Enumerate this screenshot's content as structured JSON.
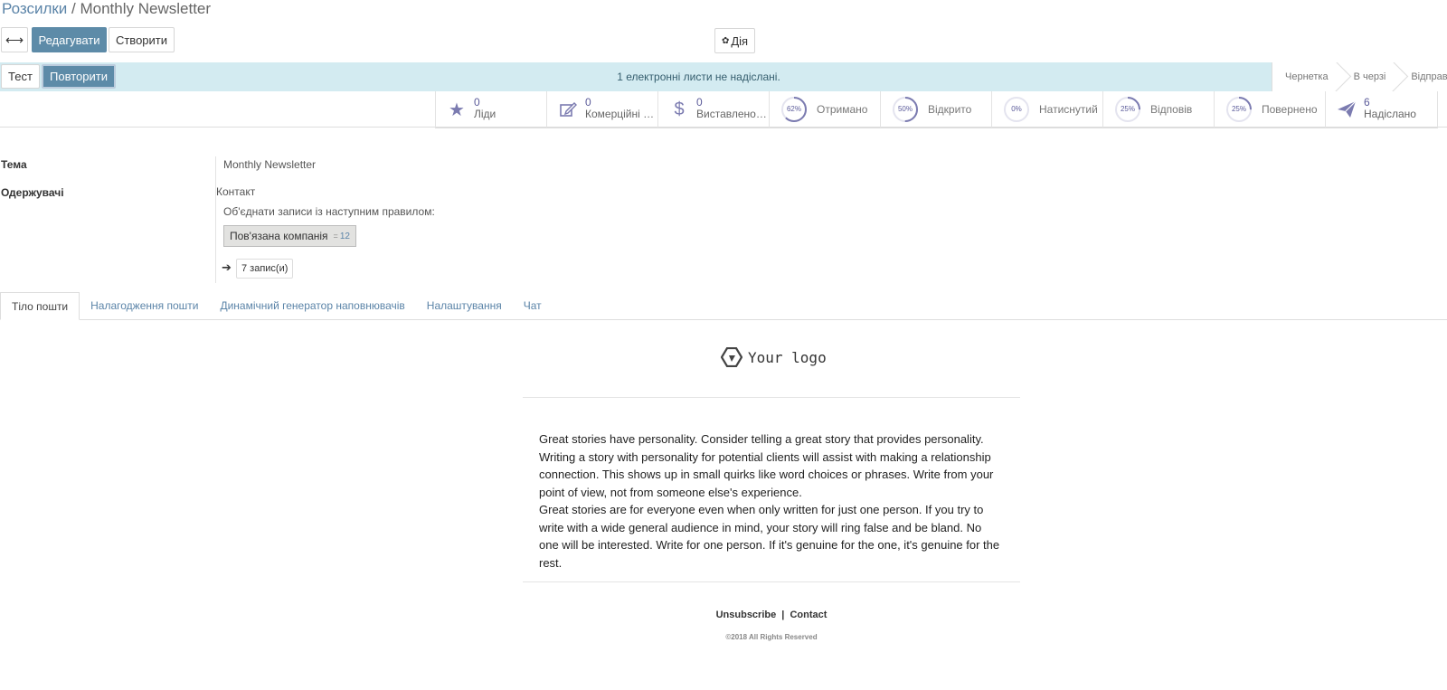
{
  "breadcrumb": {
    "parent": "Розсилки",
    "separator": " / ",
    "current": "Monthly Newsletter"
  },
  "toolbar": {
    "edit": "Редагувати",
    "create": "Створити",
    "action": "Дія"
  },
  "statusbar": {
    "test": "Тест",
    "retry": "Повторити",
    "message": "1 електронні листи не надіслані.",
    "stages": [
      "Чернетка",
      "В черзі",
      "Відправлено"
    ]
  },
  "stats": {
    "leads": {
      "value": "0",
      "label": "Ліди"
    },
    "quotations": {
      "value": "0",
      "label": "Комерційні пропозиції"
    },
    "invoiced": {
      "value": "0",
      "label": "Виставлено рахунок"
    },
    "received": {
      "percent": "62%",
      "fraction": 0.62,
      "label": "Отримано"
    },
    "opened": {
      "percent": "50%",
      "fraction": 0.5,
      "label": "Відкрито"
    },
    "clicked": {
      "percent": "0%",
      "fraction": 0.0,
      "label": "Натиснутий"
    },
    "replied": {
      "percent": "25%",
      "fraction": 0.25,
      "label": "Відповів"
    },
    "bounced": {
      "percent": "25%",
      "fraction": 0.25,
      "label": "Повернено"
    },
    "sent": {
      "value": "6",
      "label": "Надіслано"
    }
  },
  "form": {
    "subject_label": "Тема",
    "subject_value": "Monthly Newsletter",
    "recipients_label": "Одержувачі",
    "recipients_model": "Контакт",
    "rule_text": "Об'єднати записи із наступним правилом:",
    "chip_field": "Пов'язана компанія",
    "chip_operator": "=",
    "chip_value": "12",
    "records": "7 запис(и)"
  },
  "tabs": [
    "Тіло пошти",
    "Налагодження пошти",
    "Динамічний генератор наповнювачів",
    "Налаштування",
    "Чат"
  ],
  "mail": {
    "logo": "Your logo",
    "paragraph1": "Great stories have personality. Consider telling a great story that provides personality. Writing a story with personality for potential clients will assist with making a relationship connection. This shows up in small quirks like word choices or phrases. Write from your point of view, not from someone else's experience.",
    "paragraph2": "Great stories are for everyone even when only written for just one person. If you try to write with a wide general audience in mind, your story will ring false and be bland. No one will be interested. Write for one person. If it's genuine for the one, it's genuine for the rest.",
    "unsubscribe": "Unsubscribe",
    "divider": "|",
    "contact": "Contact",
    "copyright": "©2018 All Rights Reserved"
  },
  "colors": {
    "accent": "#5d8ba8",
    "status_bg": "#d3ebf1",
    "gauge": "#7b7bb0"
  },
  "icons": {
    "expand": "expand-arrows-icon",
    "action": "gear-icon",
    "leads": "star-icon",
    "quotations": "pencil-square-icon",
    "invoiced": "dollar-icon",
    "sent": "paper-plane-icon",
    "records": "arrow-right-icon"
  }
}
